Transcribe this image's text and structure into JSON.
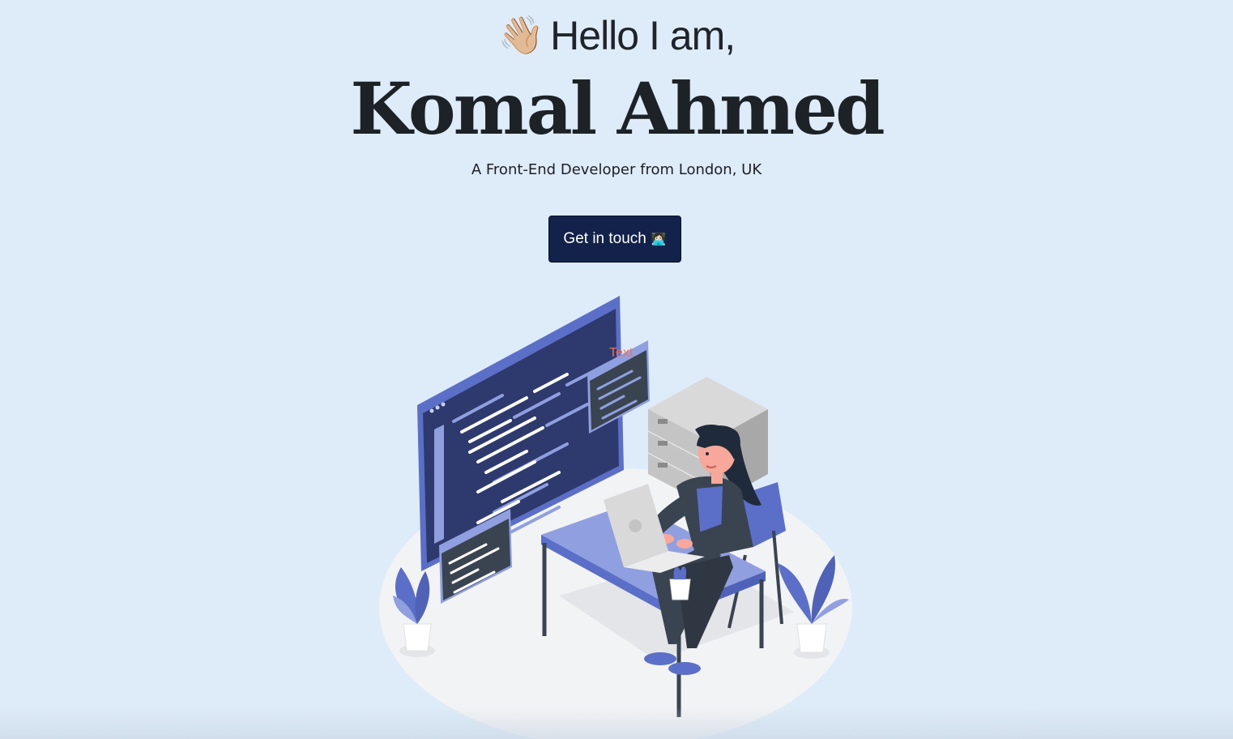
{
  "hero": {
    "wave_emoji": "👋🏼",
    "greeting": "Hello I am,",
    "name": "Komal Ahmed",
    "subtitle": "A Front-End Developer from London, UK",
    "cta_label": "Get in touch",
    "cta_emoji": "👩🏻‍💻"
  },
  "illustration": {
    "overlay_text": "Text"
  },
  "colors": {
    "background": "#deebf8",
    "button": "#13224a",
    "accent_blue": "#5b6fc8",
    "text_dark": "#1d2226"
  }
}
